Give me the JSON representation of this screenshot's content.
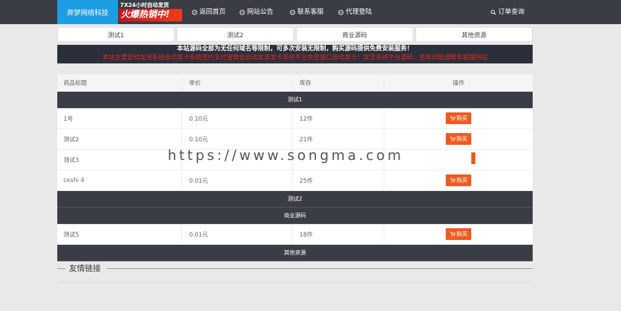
{
  "header": {
    "logo": "奔梦网络科技",
    "promo_line1": "7X24小时自动发货",
    "promo_line2": "火爆热销中!",
    "nav": [
      {
        "label": "返回首页",
        "icon": "home-icon"
      },
      {
        "label": "网站公告",
        "icon": "notice-icon"
      },
      {
        "label": "联系客服",
        "icon": "service-icon"
      },
      {
        "label": "代理登陆",
        "icon": "agent-icon"
      }
    ],
    "order_query": "订单查询"
  },
  "tabs": [
    "测试1",
    "测试2",
    "商业源码",
    "其他资源"
  ],
  "notice": {
    "line1": "本站源码全部为无任何域名等限制，可多次安装无限制，购买源码提供免费安装服务！",
    "line2": "本站主营自动发货系统自动发卡系统签约支付宝微信自动发货发卡系统平台免签接口自动发卡！发货系统平台源码，若有问题请联系客服网站"
  },
  "table": {
    "headers": [
      "商品标题",
      "单价",
      "库存",
      "操作"
    ],
    "groups": [
      {
        "name": "测试1",
        "items": [
          {
            "title": "1号",
            "price": "0.10元",
            "stock": "12件",
            "action": "购买"
          },
          {
            "title": "测试2",
            "price": "0.10元",
            "stock": "21件",
            "action": "购买"
          },
          {
            "title": "测试3",
            "price": "",
            "stock": "",
            "action": ""
          },
          {
            "title": "ceshi 4",
            "price": "0.01元",
            "stock": "25件",
            "action": "购买"
          }
        ]
      },
      {
        "name": "测试2",
        "items": []
      },
      {
        "name": "商业源码",
        "items": [
          {
            "title": "测试5",
            "price": "0.01元",
            "stock": "18件",
            "action": "购买"
          }
        ]
      },
      {
        "name": "其他资源",
        "items": []
      }
    ]
  },
  "watermark": "https://www.songma.com",
  "footer": {
    "friend_links": "友情链接"
  },
  "colors": {
    "nav_bg": "#3a3d45",
    "logo_bg": "#1e9ee2",
    "buy": "#f05a22",
    "notice_red": "#e8281f"
  }
}
